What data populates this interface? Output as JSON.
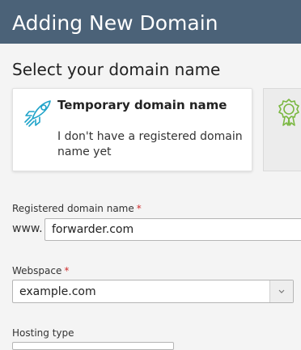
{
  "header": {
    "title": "Adding New Domain"
  },
  "section": {
    "title": "Select your domain name"
  },
  "options": [
    {
      "title": "Temporary domain name",
      "description": "I don't have a registered domain name yet",
      "icon": "rocket-icon"
    },
    {
      "icon": "award-badge-icon"
    }
  ],
  "form": {
    "registered_domain": {
      "label": "Registered domain name",
      "required_mark": "*",
      "prefix": "www.",
      "value": "forwarder.com"
    },
    "webspace": {
      "label": "Webspace",
      "required_mark": "*",
      "value": "example.com"
    },
    "hosting_type": {
      "label": "Hosting type"
    }
  },
  "colors": {
    "header_bg": "#4b6278",
    "accent_icon": "#1fa3c9",
    "badge_icon": "#7bb842",
    "required": "#d02c2c"
  }
}
